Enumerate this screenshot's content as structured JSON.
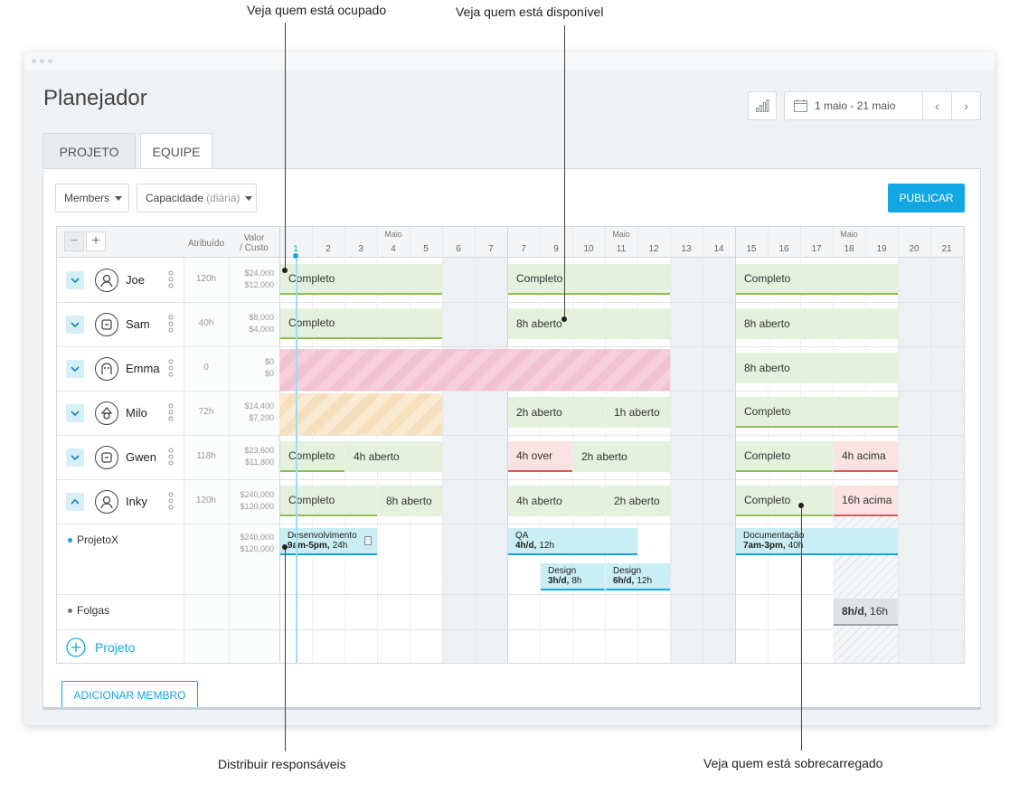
{
  "annotations": {
    "busy": "Veja quem está ocupado",
    "available": "Veja quem está disponível",
    "assign": "Distribuir responsáveis",
    "overloaded": "Veja quem está sobrecarregado"
  },
  "app": {
    "title": "Planejador",
    "date_range": "1 maio - 21 maio",
    "prev_icon": "chevron-left-icon",
    "next_icon": "chevron-right-icon",
    "chart_icon": "bar-chart-icon",
    "calendar_icon": "calendar-icon"
  },
  "tabs": [
    {
      "label": "PROJETO",
      "active": false
    },
    {
      "label": "EQUIPE",
      "active": true
    }
  ],
  "toolbar": {
    "members_label": "Members",
    "capacity_label": "Capacidade",
    "capacity_sub": "(diária)",
    "publish_label": "PUBLICAR"
  },
  "columns": {
    "assigned": "Atribuído",
    "value_line1": "Valor",
    "value_line2": "/ Custo"
  },
  "months": [
    "Maio",
    "Maio",
    "Maio"
  ],
  "days": [
    "1",
    "2",
    "3",
    "4",
    "5",
    "6",
    "7",
    "7",
    "9",
    "10",
    "11",
    "12",
    "13",
    "14",
    "15",
    "16",
    "17",
    "18",
    "19",
    "20",
    "21"
  ],
  "members": [
    {
      "name": "Joe",
      "assigned": "120h",
      "value": "$24,000",
      "cost": "$12,000",
      "expand": "chevron-down-icon",
      "avatar": "user-icon"
    },
    {
      "name": "Sam",
      "assigned": "40h",
      "value": "$8,000",
      "cost": "$4,000",
      "expand": "chevron-down-icon",
      "avatar": "robot-icon"
    },
    {
      "name": "Emma",
      "assigned": "0",
      "value": "$0",
      "cost": "$0",
      "expand": "chevron-down-icon",
      "avatar": "ghost-icon"
    },
    {
      "name": "Milo",
      "assigned": "72h",
      "value": "$14,400",
      "cost": "$7,200",
      "expand": "chevron-down-icon",
      "avatar": "hat-icon"
    },
    {
      "name": "Gwen",
      "assigned": "118h",
      "value": "$23,600",
      "cost": "$11,800",
      "expand": "chevron-down-icon",
      "avatar": "robot-icon"
    },
    {
      "name": "Inky",
      "assigned": "120h",
      "value": "$240,000",
      "cost": "$120,000",
      "expand": "chevron-up-icon",
      "avatar": "user-icon"
    }
  ],
  "segments": {
    "joe": [
      "Completo",
      "Completo",
      "Completo"
    ],
    "sam": [
      "Completo",
      "8h aberto",
      "8h aberto"
    ],
    "emma": [
      "8h aberto"
    ],
    "milo": [
      "2h aberto",
      "1h aberto",
      "Completo"
    ],
    "gwen": [
      "Completo",
      "4h aberto",
      "4h over",
      "2h aberto",
      "Completo",
      "4h acima"
    ],
    "inky": [
      "Completo",
      "8h aberto",
      "4h aberto",
      "2h aberto",
      "Completo",
      "16h acima"
    ]
  },
  "project": {
    "name": "ProjetoX",
    "value": "$240,000",
    "cost": "$120,000",
    "tasks": [
      {
        "title": "Desenvolvimento",
        "time": "9am-5pm,",
        "hours": "24h"
      },
      {
        "title": "QA",
        "time": "4h/d,",
        "hours": "12h"
      },
      {
        "title": "Documentação",
        "time": "7am-3pm,",
        "hours": "40h"
      },
      {
        "title": "Design",
        "time": "3h/d,",
        "hours": "8h"
      },
      {
        "title": "Design",
        "time": "6h/d,",
        "hours": "12h"
      }
    ]
  },
  "timeoff": {
    "name": "Folgas",
    "time": "8h/d,",
    "hours": "16h"
  },
  "add_project": "Projeto",
  "add_member": "ADICIONAR MEMBRO",
  "colors": {
    "accent": "#12a7e2",
    "complete": "#e5f1dc",
    "complete_line": "#8cc152",
    "over": "#fbe3e3",
    "over_line": "#e0574f",
    "task": "#c9eef3",
    "task_line": "#12a7e2",
    "timeoff": "#e0e3e6"
  }
}
